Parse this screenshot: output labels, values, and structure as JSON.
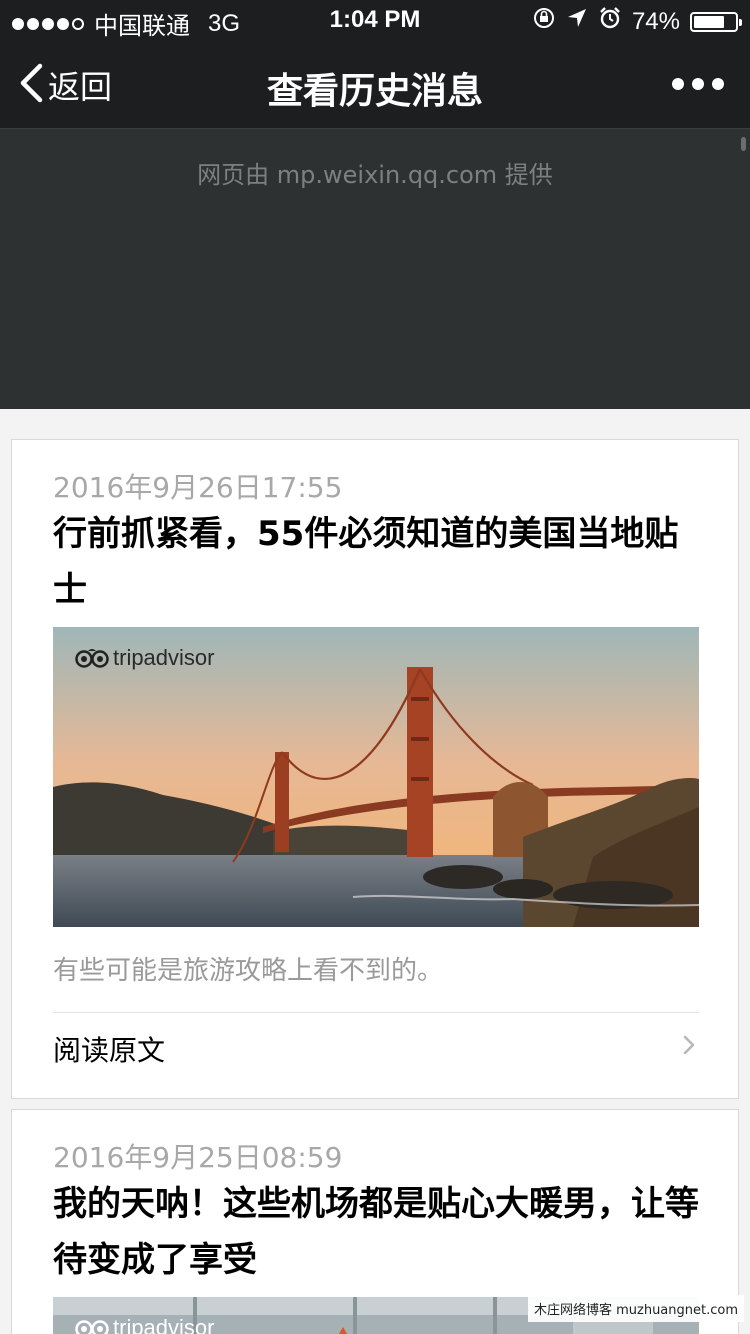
{
  "status": {
    "carrier": "中国联通",
    "network": "3G",
    "time": "1:04 PM",
    "battery": "74%",
    "battery_level": 0.74
  },
  "nav": {
    "back_label": "返回",
    "title": "查看历史消息"
  },
  "provider_text": "网页由 mp.weixin.qq.com 提供",
  "brand": "tripadvisor",
  "articles": [
    {
      "date": "2016年9月26日17:55",
      "title": "行前抓紧看，55件必须知道的美国当地贴士",
      "summary": "有些可能是旅游攻略上看不到的。",
      "read_more": "阅读原文"
    },
    {
      "date": "2016年9月25日08:59",
      "title": "我的天呐！这些机场都是贴心大暖男，让等待变成了享受"
    }
  ],
  "watermark": "木庄网络博客 muzhuangnet.com",
  "colors": {
    "navbar": "#1d1e20",
    "provider_bg": "#2e3132",
    "provider_text": "#7c8081",
    "date_text": "#a8a8a8",
    "page_bg": "#f3f3f3"
  }
}
